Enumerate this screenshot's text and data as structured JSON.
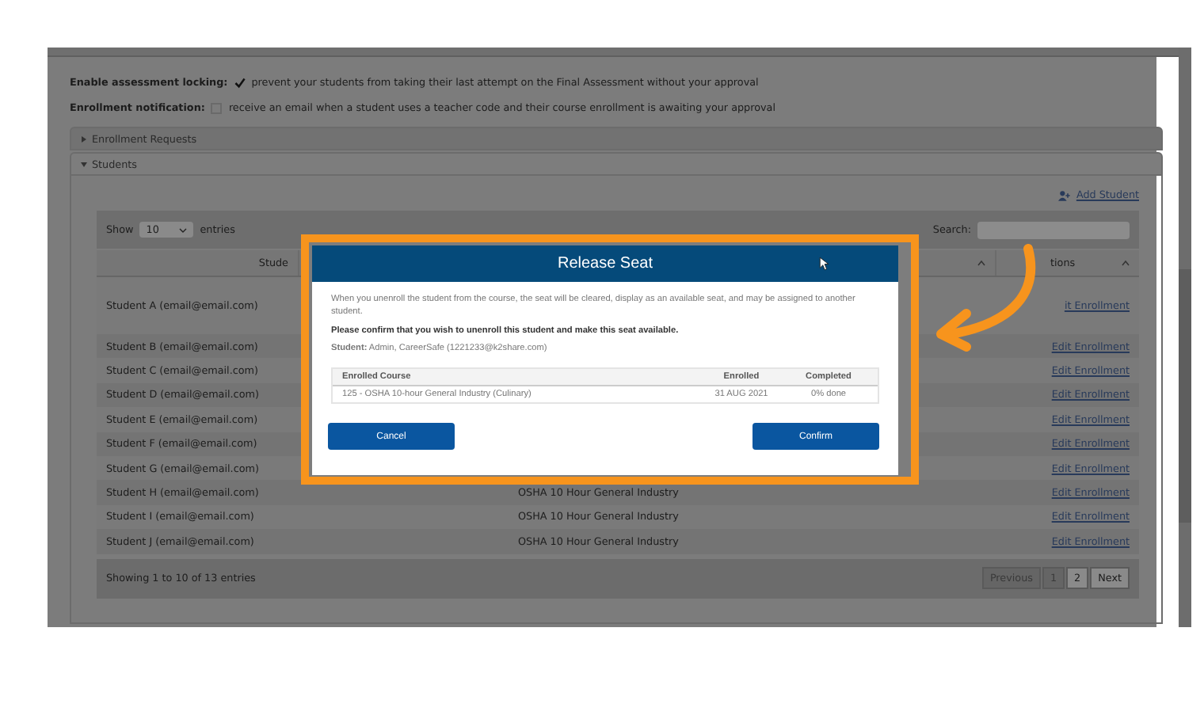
{
  "settings": [
    {
      "label": "Enable assessment locking:",
      "checked": true,
      "description": "prevent your students from taking their last attempt on the Final Assessment without your approval"
    },
    {
      "label": "Enrollment notification:",
      "checked": false,
      "description": "receive an email when a student uses a teacher code and their course enrollment is awaiting your approval"
    }
  ],
  "sections": [
    {
      "label": "Enrollment Requests",
      "expanded": false
    },
    {
      "label": "Students",
      "expanded": true
    }
  ],
  "add_student": "Add Student",
  "table": {
    "show_label": "Show",
    "page_size": "10",
    "entries_label": "entries",
    "search_label": "Search:",
    "columns": [
      "Stude",
      "tions"
    ],
    "rows": [
      {
        "student": "Student A (email@email.com)",
        "action": "it Enrollment"
      },
      {
        "student": "Student B (email@email.com)",
        "action": "Edit Enrollment"
      },
      {
        "student": "Student C (email@email.com)",
        "action": "Edit Enrollment"
      },
      {
        "student": "Student D (email@email.com)",
        "action": "Edit Enrollment"
      },
      {
        "student": "Student E (email@email.com)",
        "action": "Edit Enrollment"
      },
      {
        "student": "Student F (email@email.com)",
        "action": "Edit Enrollment"
      },
      {
        "student": "Student G (email@email.com)",
        "action": "Edit Enrollment"
      },
      {
        "student": "Student H (email@email.com)",
        "course": "OSHA 10 Hour General Industry",
        "action": "Edit Enrollment"
      },
      {
        "student": "Student I (email@email.com)",
        "course": "OSHA 10 Hour General Industry",
        "action": "Edit Enrollment"
      },
      {
        "student": "Student J (email@email.com)",
        "course": "OSHA 10 Hour General Industry",
        "action": "Edit Enrollment"
      }
    ],
    "info": "Showing 1 to 10 of 13 entries",
    "pagination": [
      {
        "label": "Previous",
        "disabled": true
      },
      {
        "label": "1",
        "disabled": true
      },
      {
        "label": "2",
        "disabled": false
      },
      {
        "label": "Next",
        "disabled": false
      }
    ]
  },
  "dialog": {
    "title": "Release Seat",
    "message": "When you unenroll the student from the course, the seat will be cleared, display as an available seat, and may be assigned to another student.",
    "prompt": "Please confirm that you wish to unenroll this student and make this seat available.",
    "student": "**Student:** Admin, CareerSafe (1221233@k2share.com)",
    "columns": [
      "Enrolled Course",
      "Enrolled",
      "Completed"
    ],
    "rows": [
      [
        "125 - OSHA 10-hour General Industry (Culinary)",
        "31 AUG 2021",
        "0% done"
      ]
    ],
    "buttons": [
      {
        "label": "Cancel"
      },
      {
        "label": "Confirm"
      }
    ]
  }
}
